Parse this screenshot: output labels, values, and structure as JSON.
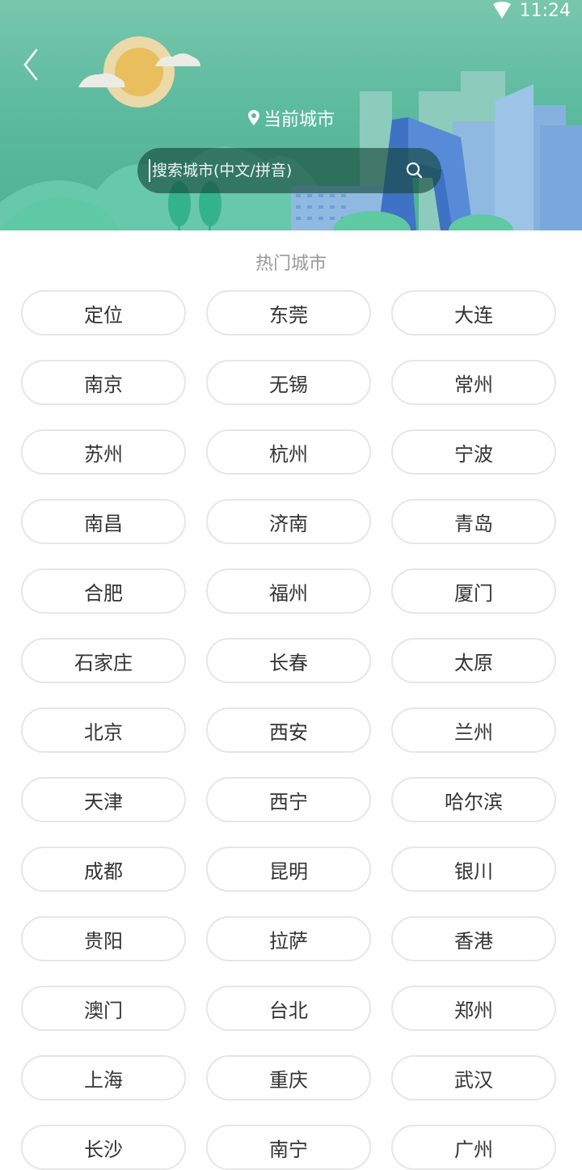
{
  "status_bar": {
    "time": "11:24",
    "wifi_icon": "wifi-icon"
  },
  "header": {
    "back_icon": "chevron-left-icon",
    "current_city_label": "当前城市",
    "location_icon": "location-pin-icon",
    "search": {
      "placeholder": "搜索城市(中文/拼音)",
      "value": "",
      "icon": "search-icon"
    }
  },
  "hot_cities": {
    "title": "热门城市",
    "items": [
      "定位",
      "东莞",
      "大连",
      "南京",
      "无锡",
      "常州",
      "苏州",
      "杭州",
      "宁波",
      "南昌",
      "济南",
      "青岛",
      "合肥",
      "福州",
      "厦门",
      "石家庄",
      "长春",
      "太原",
      "北京",
      "西安",
      "兰州",
      "天津",
      "西宁",
      "哈尔滨",
      "成都",
      "昆明",
      "银川",
      "贵阳",
      "拉萨",
      "香港",
      "澳门",
      "台北",
      "郑州",
      "上海",
      "重庆",
      "武汉",
      "长沙",
      "南宁",
      "广州"
    ]
  }
}
